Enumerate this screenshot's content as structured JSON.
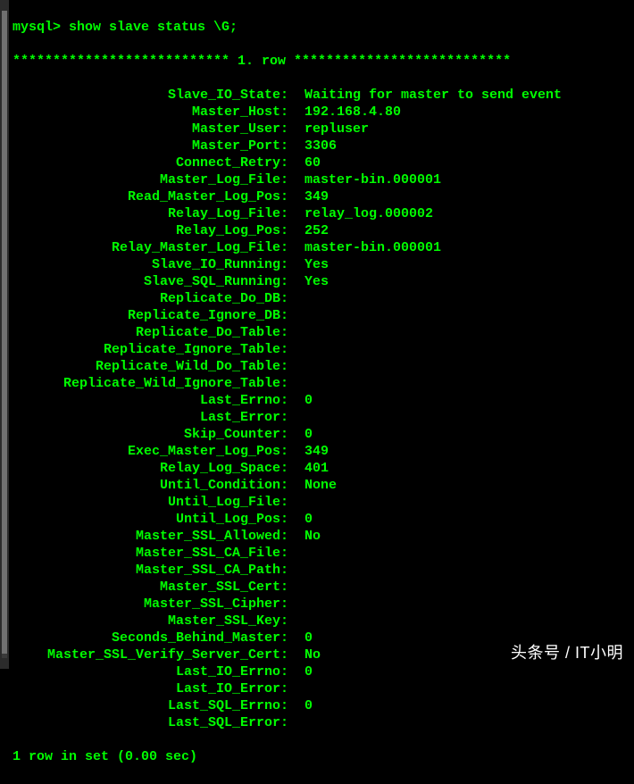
{
  "prompt": "mysql>",
  "command": "show slave status \\G;",
  "row_header": "*************************** 1. row ***************************",
  "fields": [
    {
      "k": "Slave_IO_State",
      "v": "Waiting for master to send event"
    },
    {
      "k": "Master_Host",
      "v": "192.168.4.80"
    },
    {
      "k": "Master_User",
      "v": "repluser"
    },
    {
      "k": "Master_Port",
      "v": "3306"
    },
    {
      "k": "Connect_Retry",
      "v": "60"
    },
    {
      "k": "Master_Log_File",
      "v": "master-bin.000001"
    },
    {
      "k": "Read_Master_Log_Pos",
      "v": "349"
    },
    {
      "k": "Relay_Log_File",
      "v": "relay_log.000002"
    },
    {
      "k": "Relay_Log_Pos",
      "v": "252"
    },
    {
      "k": "Relay_Master_Log_File",
      "v": "master-bin.000001"
    },
    {
      "k": "Slave_IO_Running",
      "v": "Yes"
    },
    {
      "k": "Slave_SQL_Running",
      "v": "Yes"
    },
    {
      "k": "Replicate_Do_DB",
      "v": ""
    },
    {
      "k": "Replicate_Ignore_DB",
      "v": ""
    },
    {
      "k": "Replicate_Do_Table",
      "v": ""
    },
    {
      "k": "Replicate_Ignore_Table",
      "v": ""
    },
    {
      "k": "Replicate_Wild_Do_Table",
      "v": ""
    },
    {
      "k": "Replicate_Wild_Ignore_Table",
      "v": ""
    },
    {
      "k": "Last_Errno",
      "v": "0"
    },
    {
      "k": "Last_Error",
      "v": ""
    },
    {
      "k": "Skip_Counter",
      "v": "0"
    },
    {
      "k": "Exec_Master_Log_Pos",
      "v": "349"
    },
    {
      "k": "Relay_Log_Space",
      "v": "401"
    },
    {
      "k": "Until_Condition",
      "v": "None"
    },
    {
      "k": "Until_Log_File",
      "v": ""
    },
    {
      "k": "Until_Log_Pos",
      "v": "0"
    },
    {
      "k": "Master_SSL_Allowed",
      "v": "No"
    },
    {
      "k": "Master_SSL_CA_File",
      "v": ""
    },
    {
      "k": "Master_SSL_CA_Path",
      "v": ""
    },
    {
      "k": "Master_SSL_Cert",
      "v": ""
    },
    {
      "k": "Master_SSL_Cipher",
      "v": ""
    },
    {
      "k": "Master_SSL_Key",
      "v": ""
    },
    {
      "k": "Seconds_Behind_Master",
      "v": "0"
    },
    {
      "k": "Master_SSL_Verify_Server_Cert",
      "v": "No"
    },
    {
      "k": "Last_IO_Errno",
      "v": "0"
    },
    {
      "k": "Last_IO_Error",
      "v": ""
    },
    {
      "k": "Last_SQL_Errno",
      "v": "0"
    },
    {
      "k": "Last_SQL_Error",
      "v": ""
    }
  ],
  "footer": "1 row in set (0.00 sec)",
  "watermark": "头条号 / IT小明"
}
